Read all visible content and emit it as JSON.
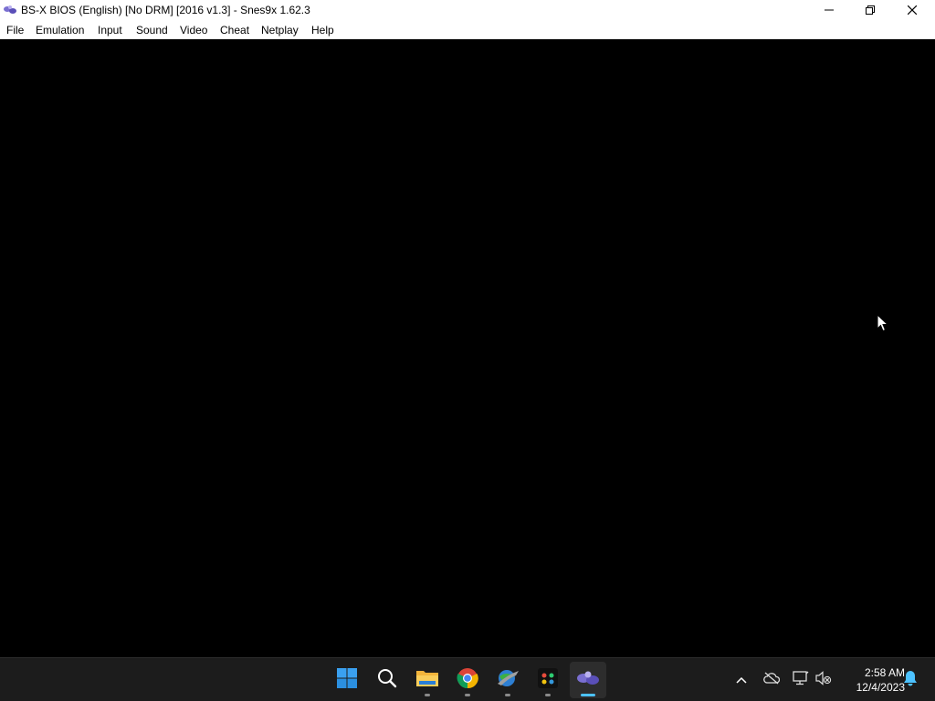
{
  "window": {
    "title": "BS-X BIOS (English) [No DRM] [2016 v1.3] - Snes9x 1.62.3",
    "app_icon": "snes9x-icon",
    "controls": [
      "minimize-icon",
      "restore-icon",
      "close-icon"
    ]
  },
  "menubar": {
    "items": [
      "File",
      "Emulation",
      "Input",
      "Sound",
      "Video",
      "Cheat",
      "Netplay",
      "Help"
    ]
  },
  "viewport": {
    "background": "#000000"
  },
  "taskbar": {
    "apps": [
      {
        "name": "start",
        "icon": "windows-start-icon",
        "running": false,
        "active": false
      },
      {
        "name": "search",
        "icon": "search-icon",
        "running": false,
        "active": false
      },
      {
        "name": "file-explorer",
        "icon": "folder-icon",
        "running": true,
        "active": false
      },
      {
        "name": "chrome",
        "icon": "chrome-icon",
        "running": true,
        "active": false
      },
      {
        "name": "internet-download-manager",
        "icon": "globe-download-icon",
        "running": true,
        "active": false
      },
      {
        "name": "gaming-app",
        "icon": "controller-app-icon",
        "running": true,
        "active": false
      },
      {
        "name": "snes9x",
        "icon": "snes9x-icon",
        "running": true,
        "active": true
      }
    ],
    "tray": [
      "chevron-up-icon",
      "cloud-offline-icon",
      "network-icon",
      "volume-muted-icon"
    ],
    "clock": {
      "time": "2:58 AM",
      "date": "12/4/2023"
    },
    "notification_icon": "bell-icon",
    "accent_color": "#4cc2ff"
  }
}
